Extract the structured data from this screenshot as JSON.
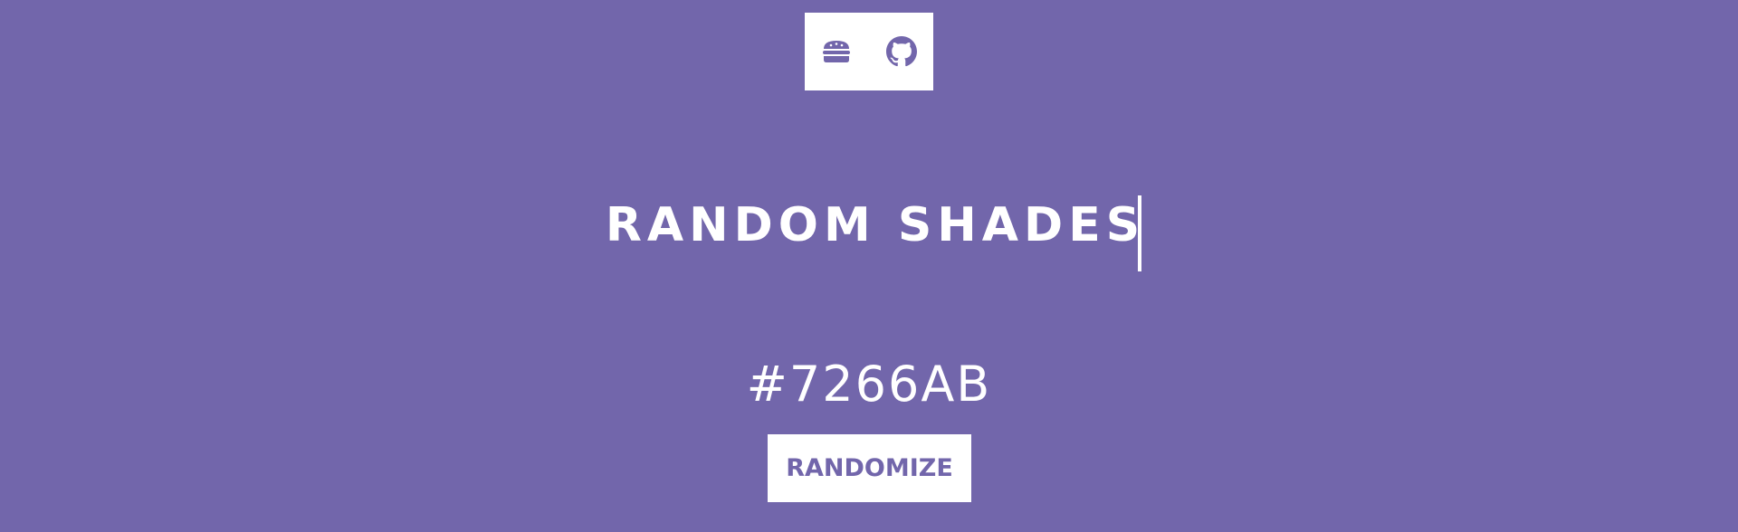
{
  "colors": {
    "background": "#7266AB",
    "text": "#ffffff",
    "button_bg": "#ffffff",
    "button_text": "#7266AB"
  },
  "header": {
    "icons": [
      {
        "name": "hamburger-menu-icon"
      },
      {
        "name": "github-icon"
      }
    ]
  },
  "title": {
    "text": "RANDOM SHADES"
  },
  "color_display": {
    "hex": "#7266AB"
  },
  "action": {
    "randomize_label": "RANDOMIZE"
  }
}
